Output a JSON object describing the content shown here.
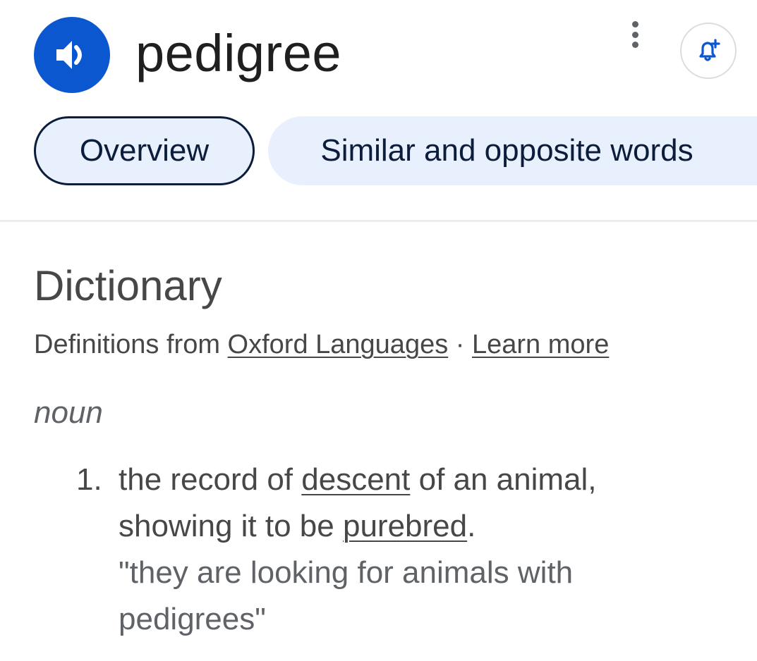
{
  "header": {
    "word": "pedigree",
    "speaker_icon": "speaker-icon",
    "more_icon": "more-vertical-icon",
    "alert_icon": "bell-plus-icon"
  },
  "tabs": [
    {
      "label": "Overview",
      "selected": true
    },
    {
      "label": "Similar and opposite words",
      "selected": false
    }
  ],
  "dictionary": {
    "title": "Dictionary",
    "source_prefix": "Definitions from ",
    "source_link": "Oxford Languages",
    "separator": " · ",
    "learn_more": "Learn more",
    "part_of_speech": "noun",
    "definitions": [
      {
        "number": "1.",
        "text_1": "the record of ",
        "link_1": "descent",
        "text_2": " of an animal, showing it to be ",
        "link_2": "purebred",
        "text_3": ".",
        "example": "\"they are looking for animals with pedigrees\""
      }
    ]
  },
  "colors": {
    "accent_blue": "#0b57d0",
    "chip_bg": "#e8f0fe",
    "chip_text": "#0b1d3a",
    "body_text": "#474747"
  }
}
